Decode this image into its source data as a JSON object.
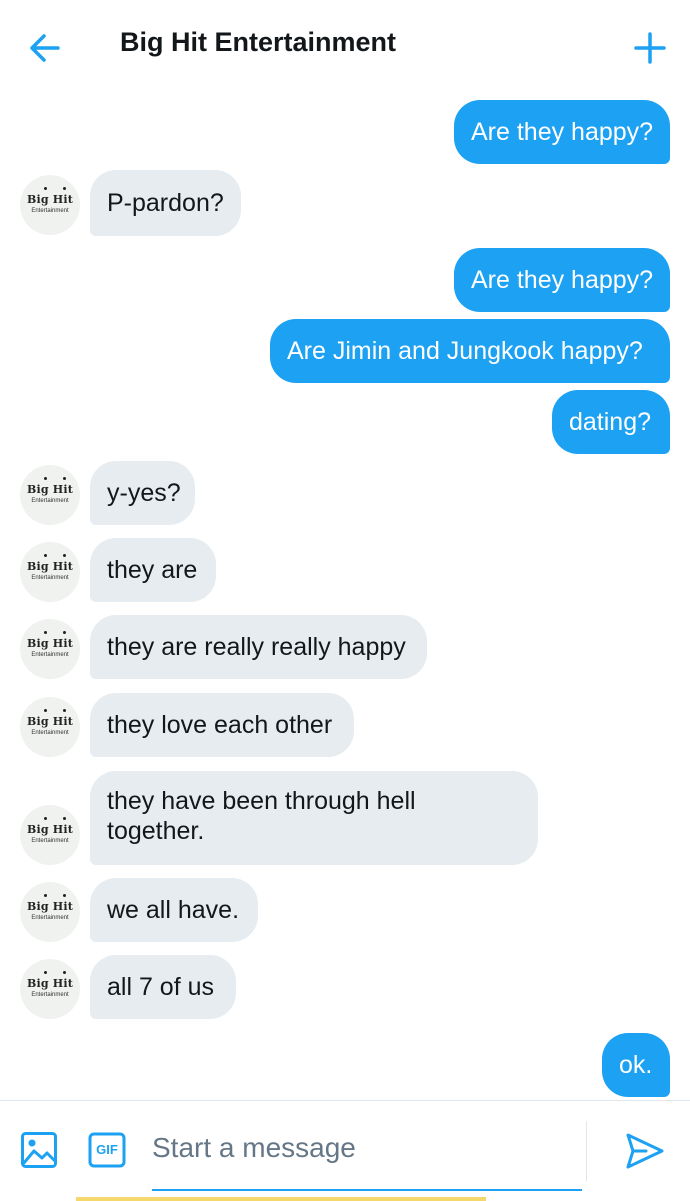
{
  "header": {
    "title": "Big Hit Entertainment",
    "back_icon": "arrow-left-icon",
    "new_icon": "plus-icon",
    "accent_color": "#1da1f2"
  },
  "avatar": {
    "logo_text": "Big Hit",
    "logo_subtext": "Entertainment"
  },
  "messages": [
    {
      "direction": "out",
      "text": "Are they happy?"
    },
    {
      "direction": "in",
      "text": "P-pardon?"
    },
    {
      "direction": "out",
      "text": "Are they happy?"
    },
    {
      "direction": "out",
      "text": "Are Jimin and Jungkook happy?"
    },
    {
      "direction": "out",
      "text": "dating?"
    },
    {
      "direction": "in",
      "text": "y-yes?"
    },
    {
      "direction": "in",
      "text": "they are"
    },
    {
      "direction": "in",
      "text": "they are really really happy"
    },
    {
      "direction": "in",
      "text": "they love each other"
    },
    {
      "direction": "in",
      "text": "they have been through hell together."
    },
    {
      "direction": "in",
      "text": "we all have."
    },
    {
      "direction": "in",
      "text": "all 7 of us"
    },
    {
      "direction": "out",
      "text": "ok."
    }
  ],
  "composer": {
    "placeholder": "Start a message",
    "image_icon": "image-icon",
    "gif_label": "GIF",
    "send_icon": "send-icon"
  },
  "colors": {
    "outgoing_bubble": "#1da1f2",
    "incoming_bubble": "#e6ecf0"
  }
}
